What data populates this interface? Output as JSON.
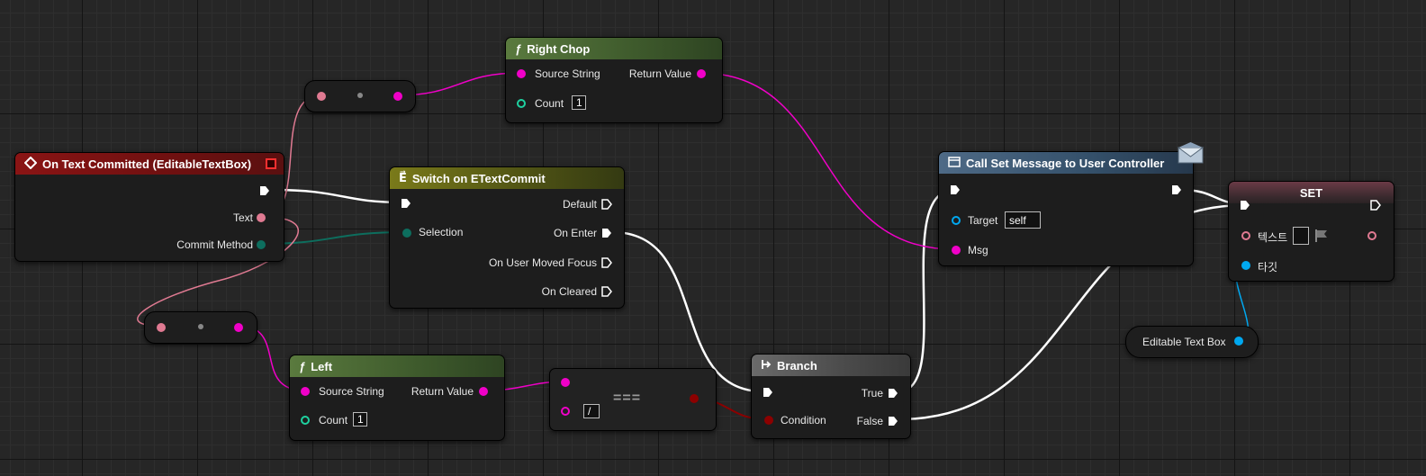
{
  "colors": {
    "exec": "#ffffff",
    "string": "#f000c8",
    "text": "#e07a92",
    "byte": "#0d6e5e",
    "int": "#1ed1a0",
    "bool": "#8c0000",
    "object": "#00a8f0"
  },
  "nodes": {
    "event": {
      "title": "On Text Committed (EditableTextBox)",
      "pin_text": "Text",
      "pin_commit": "Commit Method"
    },
    "switch": {
      "title": "Switch on ETextCommit",
      "pin_selection": "Selection",
      "out_default": "Default",
      "out_enter": "On Enter",
      "out_focus": "On User Moved Focus",
      "out_cleared": "On Cleared"
    },
    "right_chop": {
      "title": "Right Chop",
      "pin_source": "Source String",
      "pin_count": "Count",
      "count_value": "1",
      "pin_return": "Return Value"
    },
    "left": {
      "title": "Left",
      "pin_source": "Source String",
      "pin_count": "Count",
      "count_value": "1",
      "pin_return": "Return Value"
    },
    "equal": {
      "symbol": "===",
      "value": "/"
    },
    "branch": {
      "title": "Branch",
      "pin_condition": "Condition",
      "out_true": "True",
      "out_false": "False"
    },
    "call_set_message": {
      "title": "Call Set Message to User Controller",
      "pin_target": "Target",
      "target_value": "self",
      "pin_msg": "Msg"
    },
    "set": {
      "title": "SET",
      "pin_text": "텍스트",
      "pin_target": "타깃"
    },
    "editable_text_box": {
      "label": "Editable Text Box"
    }
  },
  "icons": {
    "function": "ƒ",
    "event": "diamond-event-icon",
    "switch": "switch-icon",
    "branch": "branch-icon",
    "message": "envelope-icon"
  }
}
